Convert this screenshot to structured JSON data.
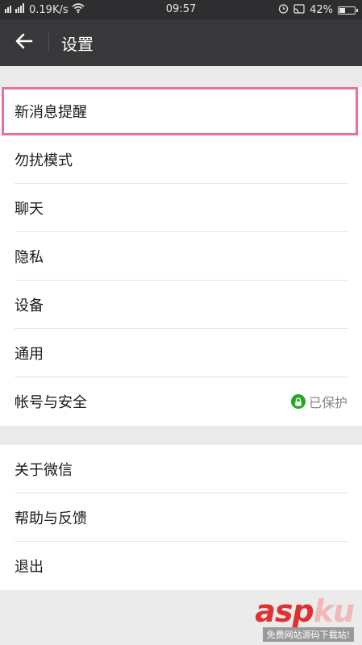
{
  "status_bar": {
    "speed": "0.19K/s",
    "time": "09:57",
    "battery": "42%",
    "battery_level": 0.42
  },
  "nav": {
    "title": "设置"
  },
  "groups": [
    {
      "items": [
        {
          "label": "新消息提醒"
        },
        {
          "label": "勿扰模式"
        },
        {
          "label": "聊天"
        },
        {
          "label": "隐私"
        },
        {
          "label": "设备"
        },
        {
          "label": "通用"
        },
        {
          "label": "帐号与安全",
          "status": "已保护"
        }
      ]
    },
    {
      "items": [
        {
          "label": "关于微信"
        },
        {
          "label": "帮助与反馈"
        },
        {
          "label": "退出"
        }
      ]
    }
  ],
  "watermark": {
    "main": "asp",
    "accent": "ku",
    "sub": "免费网站源码下载站!"
  },
  "colors": {
    "highlight_border": "#ee6f98",
    "secure_green": "#1aad19"
  }
}
